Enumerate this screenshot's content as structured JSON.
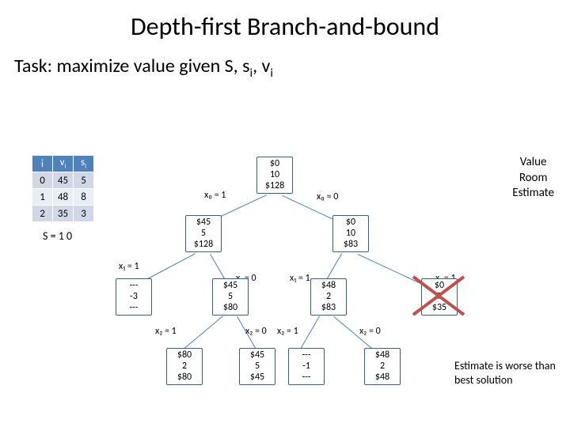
{
  "title": "Depth-first Branch-and-bound",
  "task_prefix": "Task: maximize value given S, s",
  "task_mid": ",  v",
  "task_sub": "i",
  "table": {
    "headers": [
      "i",
      "v_i",
      "s_i"
    ],
    "rows": [
      [
        "0",
        "45",
        "5"
      ],
      [
        "1",
        "48",
        "8"
      ],
      [
        "2",
        "35",
        "3"
      ]
    ]
  },
  "S_label": "S = 1 0",
  "legend": {
    "l1": "Value",
    "l2": "Room",
    "l3": "Estimate"
  },
  "nodes": {
    "root": {
      "v": "$0",
      "r": "10",
      "e": "$128"
    },
    "n0": {
      "v": "$45",
      "r": "5",
      "e": "$128"
    },
    "n1": {
      "v": "$0",
      "r": "10",
      "e": "$83"
    },
    "n00": {
      "v": "---",
      "r": "-3",
      "e": "---"
    },
    "n01": {
      "v": "$45",
      "r": "5",
      "e": "$80"
    },
    "n10": {
      "v": "$48",
      "r": "2",
      "e": "$83"
    },
    "n11": {
      "v": "$0",
      "r": "7",
      "e": "$35"
    },
    "n010": {
      "v": "$80",
      "r": "2",
      "e": "$80"
    },
    "n011": {
      "v": "$45",
      "r": "5",
      "e": "$45"
    },
    "n100": {
      "v": "---",
      "r": "-1",
      "e": "---"
    },
    "n101": {
      "v": "$48",
      "r": "2",
      "e": "$48"
    }
  },
  "edges": {
    "e_root_L": "x₀ = 1",
    "e_root_R": "x₀ = 0",
    "e_n0_L": "x₁ = 1",
    "e_n0_R": "x₁ = 0",
    "e_n1_L": "x₁ = 1",
    "e_n1_R": "x₁ = 1",
    "e_n01_L": "x₂ = 1",
    "e_n01_R": "x₂ = 0",
    "e_n10_L": "x₂ = 1",
    "e_n10_R": "x₂ = 0"
  },
  "note": "Estimate is worse than best solution"
}
